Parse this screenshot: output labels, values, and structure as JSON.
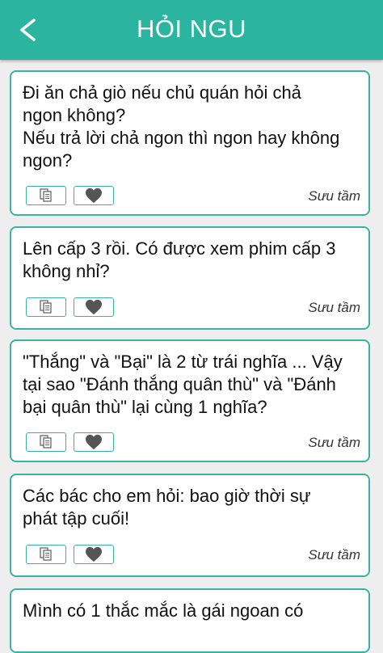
{
  "header": {
    "title": "HỎI NGU",
    "back_icon": "chevron-left-icon"
  },
  "posts": [
    {
      "text": "Đi ăn chả giò nếu chủ quán hỏi chả\nngon không?\nNếu trả lời chả ngon thì ngon hay không\nngon?",
      "source": "Sưu tầm"
    },
    {
      "text": "Lên cấp 3 rồi. Có được xem phim cấp 3\nkhông nhỉ?",
      "source": "Sưu tầm"
    },
    {
      "text": "\"Thắng\" và \"Bại\" là 2 từ trái nghĩa ... Vậy\ntại sao \"Đánh thắng quân thù\" và \"Đánh\nbại quân thù\" lại cùng 1 nghĩa?",
      "source": "Sưu tầm"
    },
    {
      "text": "Các bác cho em hỏi: bao giờ thời sự\nphát tập cuối!",
      "source": "Sưu tầm"
    },
    {
      "text": "Mình có 1 thắc mắc là gái ngoan có"
    }
  ],
  "colors": {
    "accent": "#2bb5a1",
    "border": "#39b3a3",
    "heart": "#555555"
  }
}
